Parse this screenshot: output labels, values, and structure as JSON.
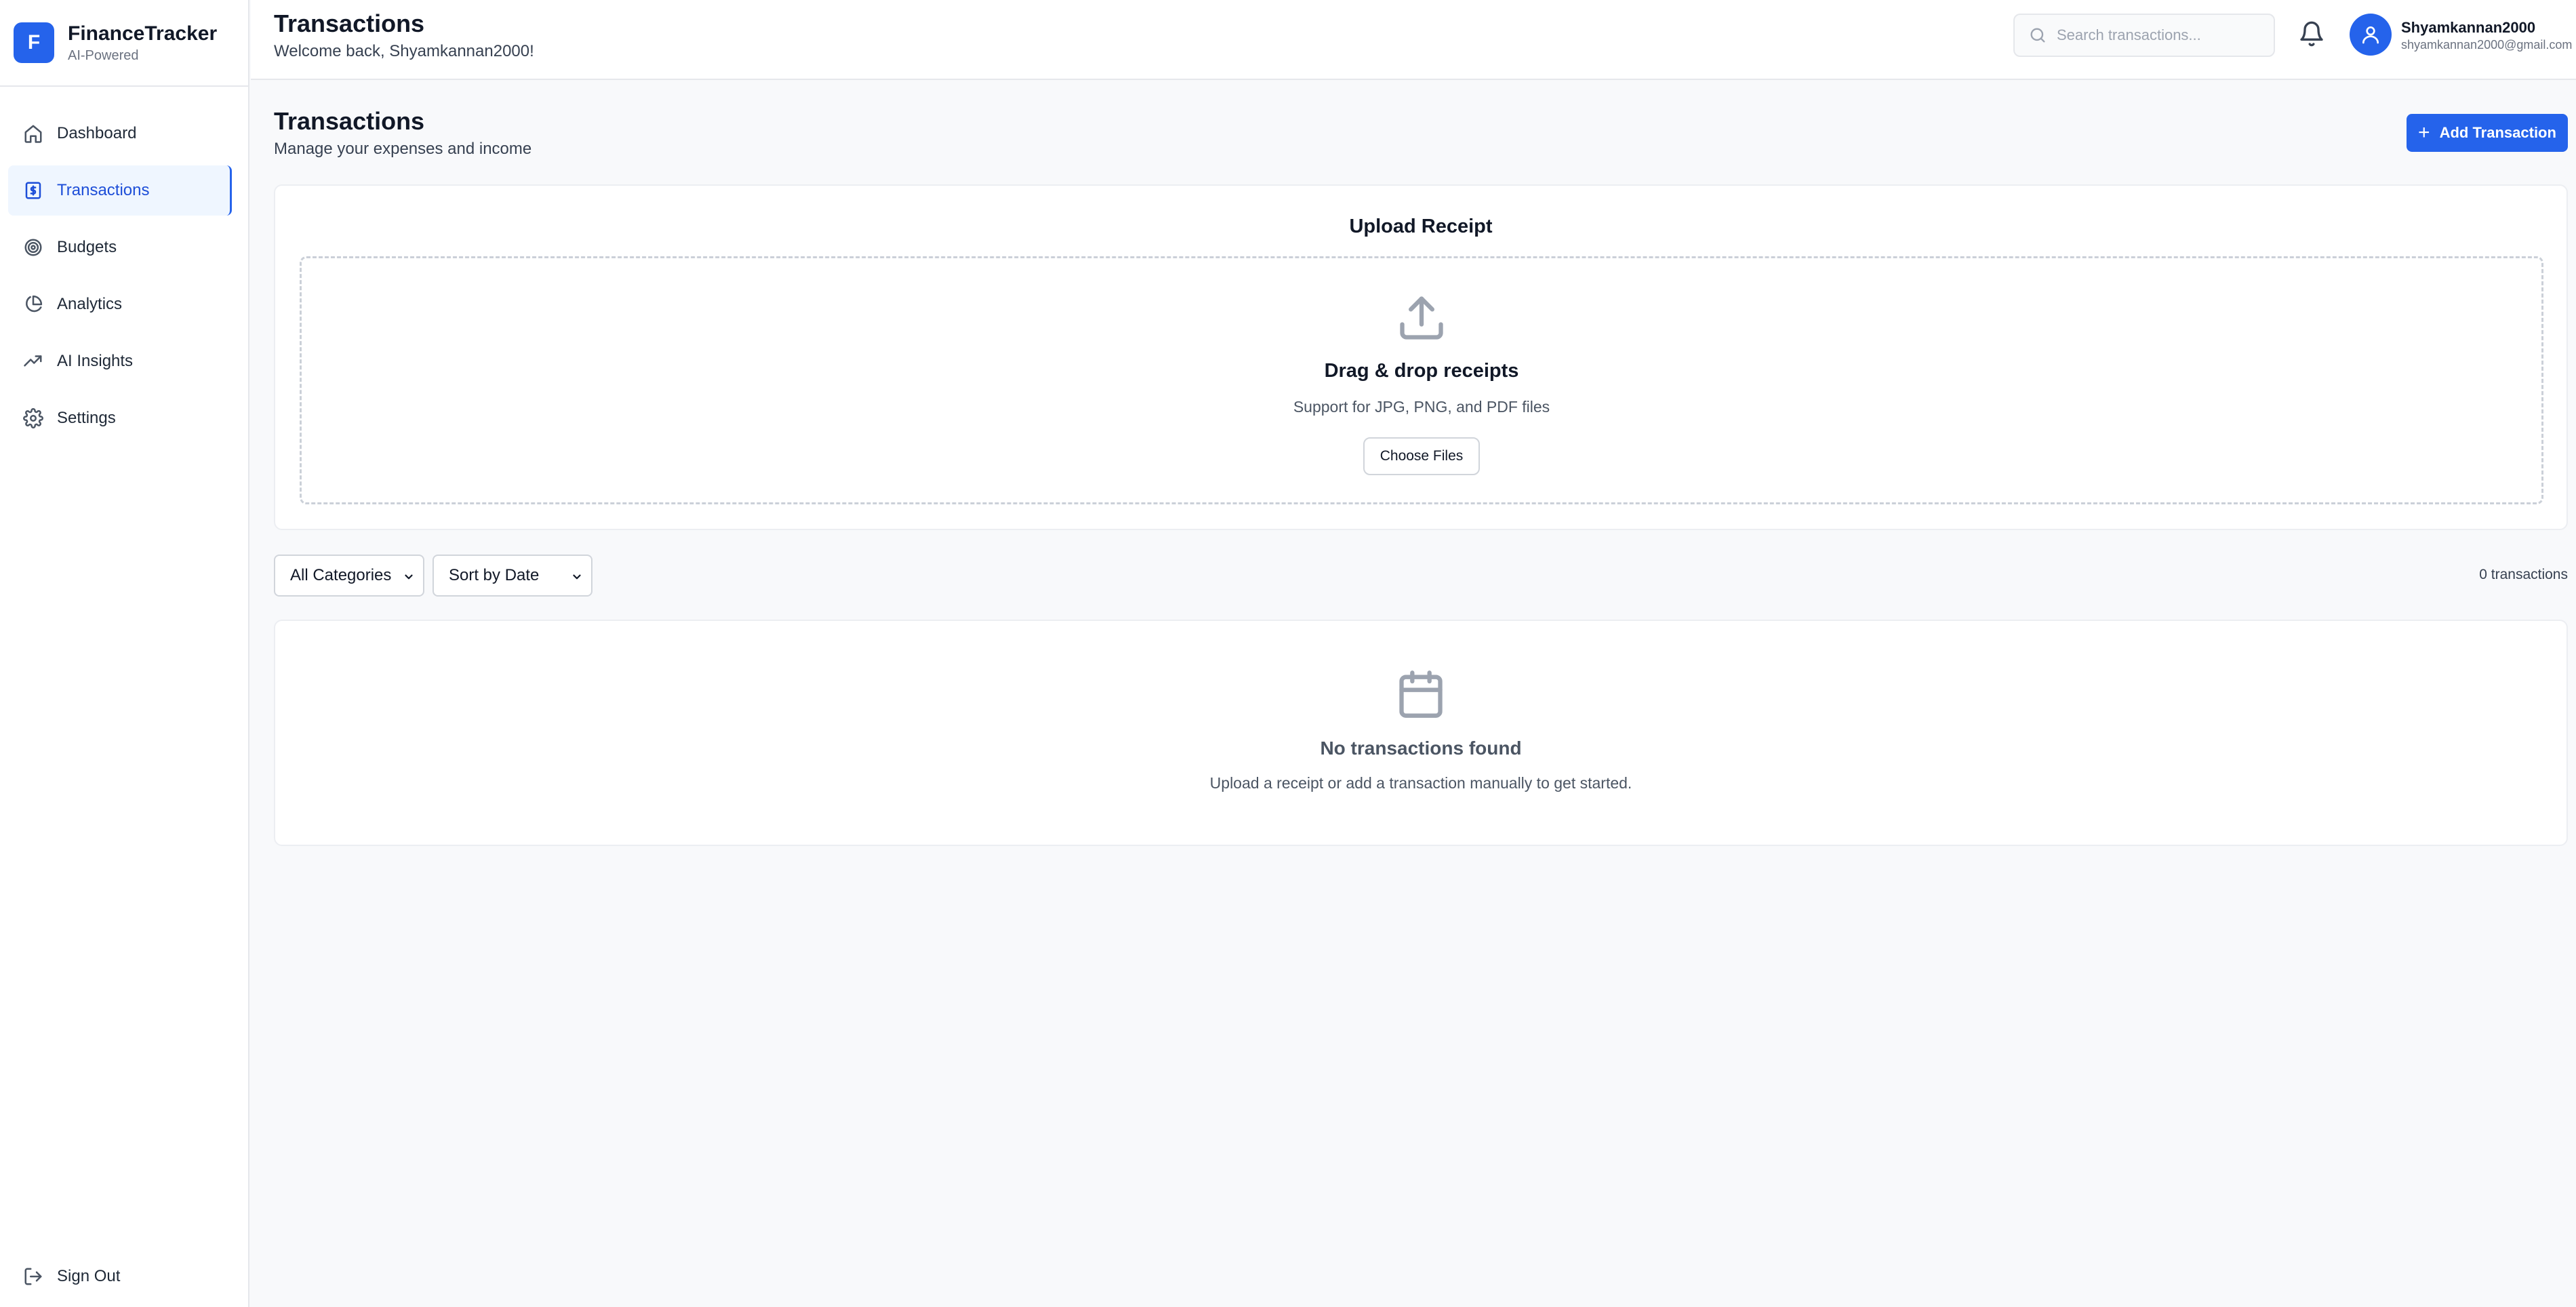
{
  "brand": {
    "logo_letter": "F",
    "name": "FinanceTracker",
    "tagline": "AI-Powered"
  },
  "sidebar": {
    "items": [
      {
        "label": "Dashboard",
        "icon": "home-icon",
        "active": false
      },
      {
        "label": "Transactions",
        "icon": "receipt-icon",
        "active": true
      },
      {
        "label": "Budgets",
        "icon": "target-icon",
        "active": false
      },
      {
        "label": "Analytics",
        "icon": "pie-chart-icon",
        "active": false
      },
      {
        "label": "AI Insights",
        "icon": "trending-up-icon",
        "active": false
      },
      {
        "label": "Settings",
        "icon": "gear-icon",
        "active": false
      }
    ],
    "signout_label": "Sign Out"
  },
  "header": {
    "title": "Transactions",
    "welcome": "Welcome back, Shyamkannan2000!",
    "search_placeholder": "Search transactions...",
    "user_name": "Shyamkannan2000",
    "user_email": "shyamkannan2000@gmail.com"
  },
  "main": {
    "title": "Transactions",
    "subtitle": "Manage your expenses and income",
    "add_button": "Add Transaction",
    "upload": {
      "title": "Upload Receipt",
      "drag_title": "Drag & drop receipts",
      "support_text": "Support for JPG, PNG, and PDF files",
      "choose_button": "Choose Files"
    },
    "filters": {
      "category_selected": "All Categories",
      "sort_selected": "Sort by Date"
    },
    "count_text": "0 transactions",
    "empty": {
      "title": "No transactions found",
      "subtitle": "Upload a receipt or add a transaction manually to get started."
    }
  },
  "colors": {
    "accent": "#2563eb",
    "active_bg": "#eff6ff",
    "border": "#e5e7eb"
  }
}
